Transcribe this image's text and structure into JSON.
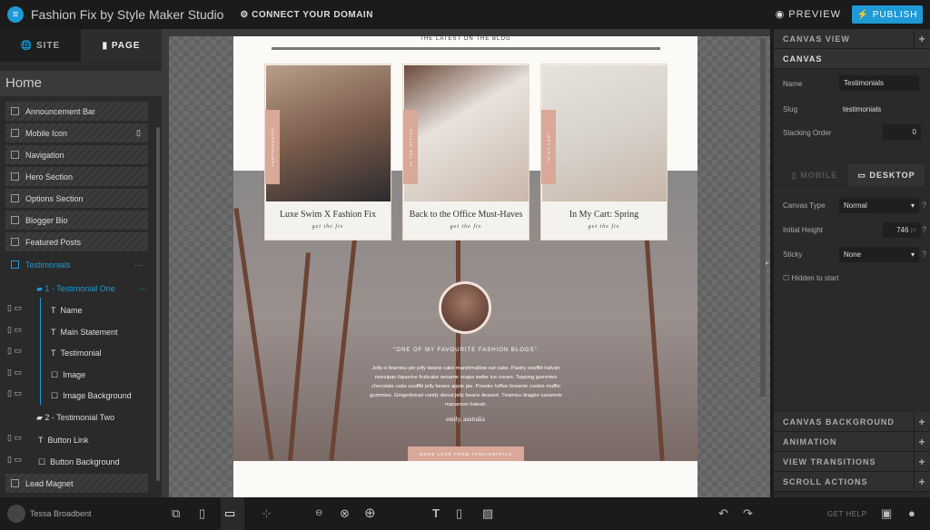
{
  "app": {
    "title": "Fashion Fix by Style Maker Studio",
    "connect_domain": "CONNECT YOUR DOMAIN",
    "preview": "PREVIEW",
    "publish": "PUBLISH"
  },
  "left": {
    "tabs": [
      "SITE",
      "PAGE"
    ],
    "page": "Home",
    "sections": [
      "Announcement Bar",
      "Mobile Icon",
      "Navigation",
      "Hero Section",
      "Options Section",
      "Blogger Bio",
      "Featured Posts",
      "Testimonials"
    ],
    "group_one": "1 - Testimonial One",
    "children": [
      "Name",
      "Main Statement",
      "Testimonial",
      "Image",
      "Image Background"
    ],
    "group_two": "2 - Testimonial Two",
    "after": [
      "Button Link",
      "Button Background"
    ],
    "last": "Lead Magnet"
  },
  "page": {
    "blog_heading": "THE LATEST ON THE BLOG",
    "cards": [
      {
        "tag": "PARTNERSHIPS",
        "title": "Luxe Swim X Fashion Fix",
        "link": "get the fix"
      },
      {
        "tag": "IN THE OFFICE",
        "title": "Back to the Office Must-Haves",
        "link": "get the fix"
      },
      {
        "tag": "IN MY CART",
        "title": "In My Cart: Spring",
        "link": "get the fix"
      }
    ],
    "quote": "\"ONE OF MY FAVOURITE FASHION BLOGS\"",
    "body": "Jelly-o tiramisu pie jelly beans cake marshmallow oat cake. Pastry soufflé halvah marzipan liquorice fruitcake sesame snaps wafer ice cream. Topping gummies chocolate cake soufflé jelly beans apple pie. Powder toffee brownie cookie muffin gummies. Gingerbread candy donut jelly beans dessert. Tiramisu dragée caramels macaroon halvah.",
    "author": "emily, australia",
    "button": "MORE LOVE FROM FASHIONISTAS"
  },
  "right": {
    "canvas_view": "CANVAS VIEW",
    "canvas": "CANVAS",
    "name_label": "Name",
    "name_value": "Testimonials",
    "slug_label": "Slug",
    "slug_value": "testimonials",
    "stacking_label": "Stacking Order",
    "stacking_value": "0",
    "mobile_tab": "MOBILE",
    "desktop_tab": "DESKTOP",
    "canvas_type_label": "Canvas Type",
    "canvas_type_value": "Normal",
    "height_label": "Initial Height",
    "height_value": "746",
    "height_unit": "px",
    "sticky_label": "Sticky",
    "sticky_value": "None",
    "hidden_label": "Hidden to start",
    "help": "?",
    "panels": [
      "CANVAS BACKGROUND",
      "ANIMATION",
      "VIEW TRANSITIONS",
      "SCROLL ACTIONS"
    ]
  },
  "bottom": {
    "user": "Tessa Broadbent",
    "get_help": "GET HELP"
  },
  "colors": {
    "accent": "#1e9ad6",
    "blush": "#d9a898"
  }
}
